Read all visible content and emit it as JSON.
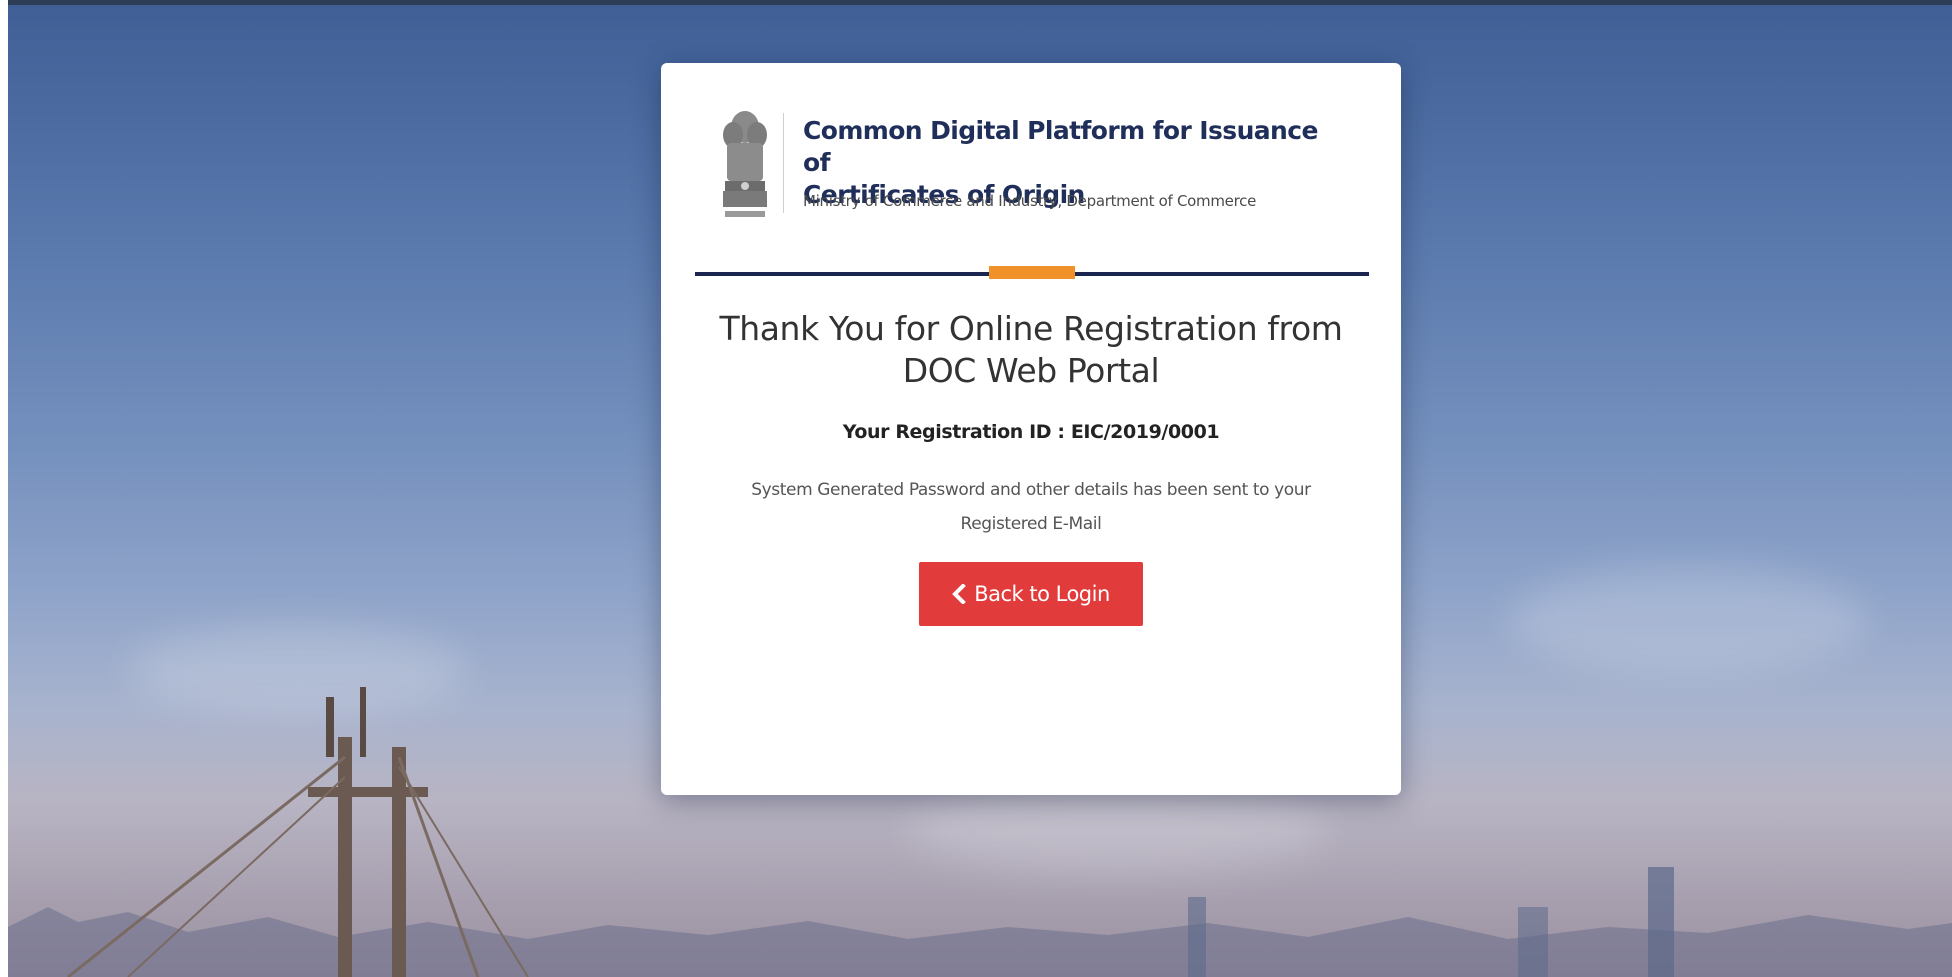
{
  "header": {
    "title_line1": "Common Digital Platform for Issuance of",
    "title_line2": "Certificates of Origin",
    "subtitle": "Ministry of Commerce and Industry, Department of Commerce"
  },
  "message": {
    "heading_line1": "Thank You for Online Registration from",
    "heading_line2": "DOC Web Portal",
    "registration_label": "Your Registration ID : ",
    "registration_id": "EIC/2019/0001",
    "info_line1": "System Generated Password and other details has been sent to your",
    "info_line2": "Registered E-Mail"
  },
  "actions": {
    "back_label": "Back to Login",
    "back_icon": "chevron-left-icon"
  },
  "colors": {
    "brand_navy": "#1a2550",
    "accent_orange": "#f0912a",
    "button_red": "#e23b3b"
  }
}
